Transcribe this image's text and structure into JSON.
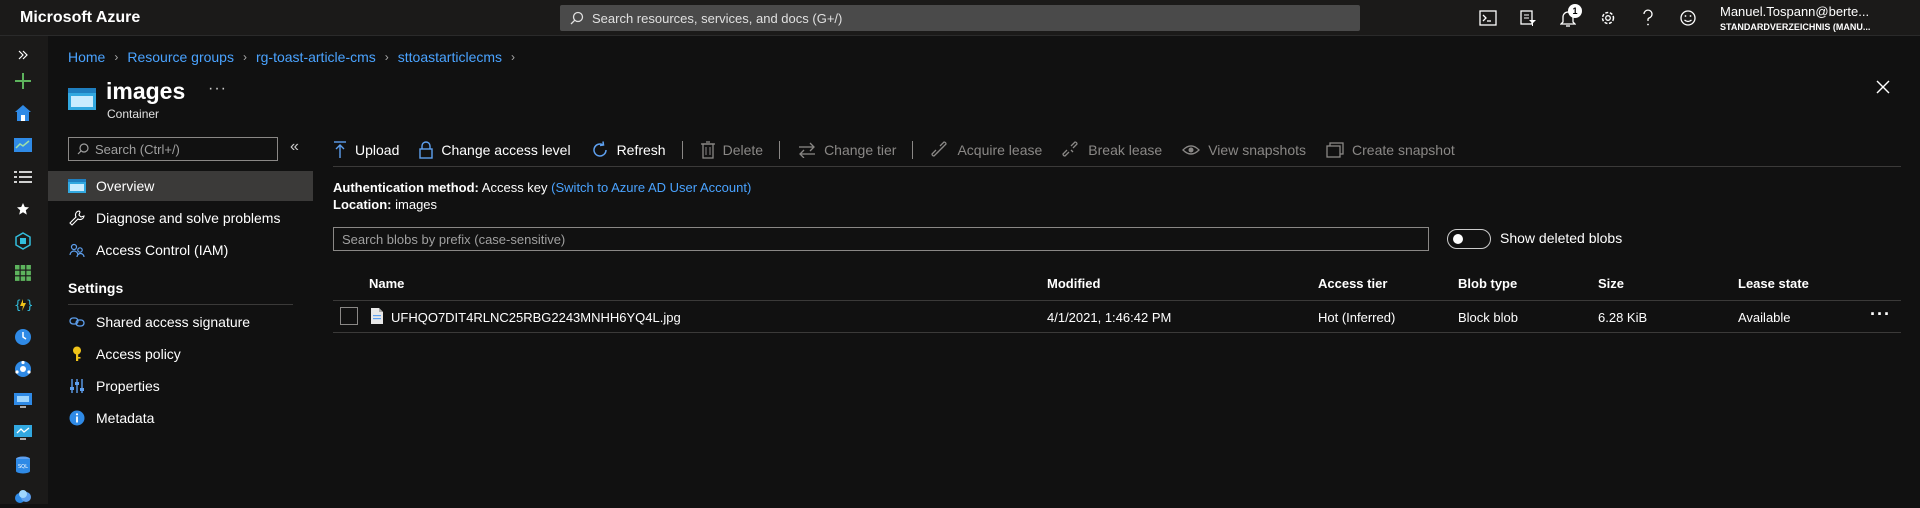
{
  "topbar": {
    "brand": "Microsoft Azure",
    "search_placeholder": "Search resources, services, and docs (G+/)",
    "notification_count": "1",
    "account_name": "Manuel.Tospann@berte...",
    "account_directory": "STANDARDVERZEICHNIS (MANU..."
  },
  "breadcrumb": [
    "Home",
    "Resource groups",
    "rg-toast-article-cms",
    "sttoastarticlecms"
  ],
  "page": {
    "title": "images",
    "subtitle": "Container",
    "more": "···"
  },
  "menu": {
    "search_placeholder": "Search (Ctrl+/)",
    "collapse": "«",
    "items": [
      {
        "label": "Overview",
        "icon": "container-icon"
      },
      {
        "label": "Diagnose and solve problems",
        "icon": "wrench-icon"
      },
      {
        "label": "Access Control (IAM)",
        "icon": "people-icon"
      }
    ],
    "settings_heading": "Settings",
    "settings_items": [
      {
        "label": "Shared access signature",
        "icon": "link-icon"
      },
      {
        "label": "Access policy",
        "icon": "key-icon"
      },
      {
        "label": "Properties",
        "icon": "properties-icon"
      },
      {
        "label": "Metadata",
        "icon": "info-icon"
      }
    ]
  },
  "toolbar": {
    "upload": "Upload",
    "change_access_level": "Change access level",
    "refresh": "Refresh",
    "delete": "Delete",
    "change_tier": "Change tier",
    "acquire_lease": "Acquire lease",
    "break_lease": "Break lease",
    "view_snapshots": "View snapshots",
    "create_snapshot": "Create snapshot"
  },
  "info": {
    "auth_label": "Authentication method:",
    "auth_value": "Access key",
    "auth_link": "(Switch to Azure AD User Account)",
    "location_label": "Location:",
    "location_value": "images"
  },
  "blob_search_placeholder": "Search blobs by prefix (case-sensitive)",
  "show_deleted_label": "Show deleted blobs",
  "table": {
    "headers": {
      "name": "Name",
      "modified": "Modified",
      "access_tier": "Access tier",
      "blob_type": "Blob type",
      "size": "Size",
      "lease_state": "Lease state"
    },
    "rows": [
      {
        "name": "UFHQO7DIT4RLNC25RBG2243MNHH6YQ4L.jpg",
        "modified": "4/1/2021, 1:46:42 PM",
        "access_tier": "Hot (Inferred)",
        "blob_type": "Block blob",
        "size": "6.28 KiB",
        "lease_state": "Available",
        "more": "···"
      }
    ]
  },
  "colors": {
    "link": "#4aa3ff",
    "background": "#111111",
    "topbar": "#1b1a19",
    "active_menu": "#3b3a39"
  }
}
